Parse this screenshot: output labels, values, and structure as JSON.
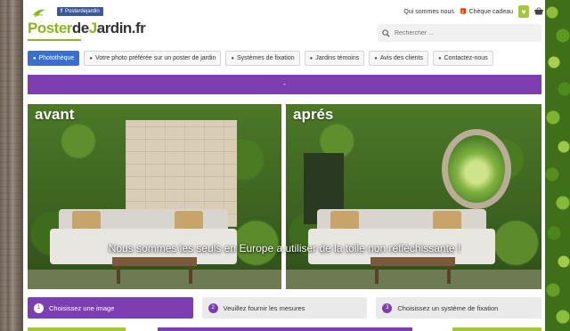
{
  "header": {
    "facebook_badge": "Posterdejardin",
    "logo": {
      "part1": "Poster",
      "part2": "de",
      "part3": "J",
      "part4": "ardin.fr"
    },
    "links": {
      "about": "Qui sommes nous",
      "gift": "Chèque cadeau"
    },
    "search": {
      "placeholder": "Rechercher ..."
    }
  },
  "nav": {
    "items": [
      {
        "label": "Photothèque",
        "active": true
      },
      {
        "label": "Votre photo préférée sur un poster de jardin",
        "active": false
      },
      {
        "label": "Systèmes de fixation",
        "active": false
      },
      {
        "label": "Jardins témoins",
        "active": false
      },
      {
        "label": "Avis des clients",
        "active": false
      },
      {
        "label": "Contactez-nous",
        "active": false
      }
    ]
  },
  "promo_bar": {
    "text": "-"
  },
  "banner": {
    "before_label": "avant",
    "after_label": "aprés",
    "caption": "Nous sommes les seuls en Europe a utiliser de la toile non réfléchissante !"
  },
  "steps": [
    {
      "number": "1",
      "label": "Choisissez une image",
      "active": true
    },
    {
      "number": "2",
      "label": "Veuillez fournir les mesures",
      "active": false
    },
    {
      "number": "3",
      "label": "Choisissez un système de fixation",
      "active": false
    }
  ],
  "icons": {
    "facebook": "facebook-icon",
    "gift": "gift-icon",
    "wishlist": "heart-icon",
    "cart": "basket-icon",
    "search": "search-icon"
  },
  "colors": {
    "brand_green": "#8db51f",
    "purple": "#7d3fb0",
    "nav_active": "#3a6fcf",
    "facebook_blue": "#3b5998"
  }
}
